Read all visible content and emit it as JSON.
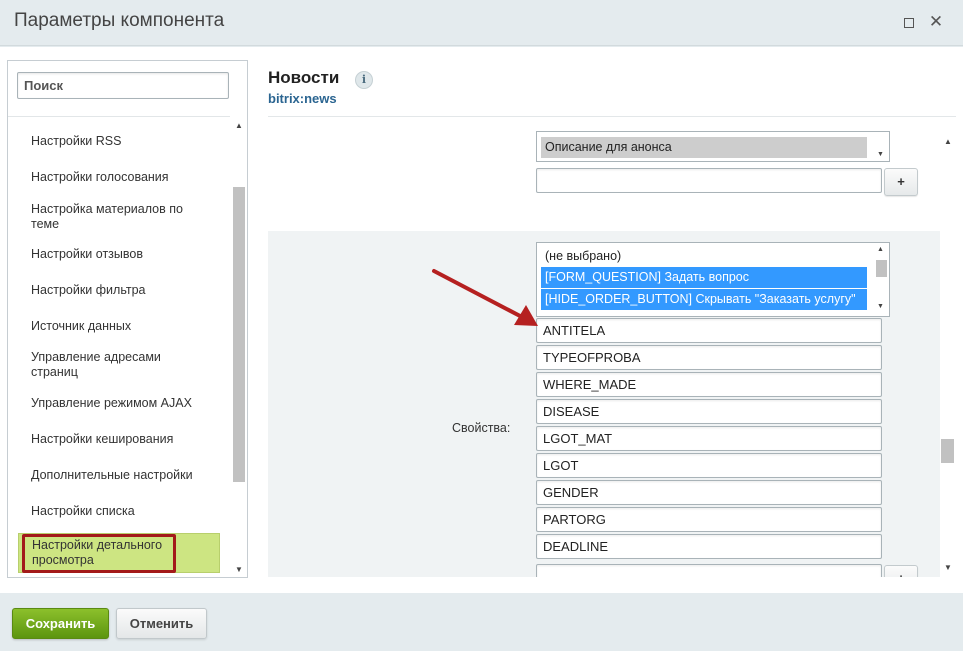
{
  "window": {
    "title": "Параметры компонента"
  },
  "sidebar": {
    "search_placeholder": "Поиск",
    "items": [
      {
        "label": "Настройки RSS"
      },
      {
        "label": "Настройки голосования"
      },
      {
        "label": "Настройка материалов по теме"
      },
      {
        "label": "Настройки отзывов"
      },
      {
        "label": "Настройки фильтра"
      },
      {
        "label": "Источник данных"
      },
      {
        "label": "Управление адресами страниц"
      },
      {
        "label": "Управление режимом AJAX"
      },
      {
        "label": "Настройки кеширования"
      },
      {
        "label": "Дополнительные настройки"
      },
      {
        "label": "Настройки списка"
      },
      {
        "label": "Настройки детального просмотра"
      }
    ]
  },
  "header": {
    "title": "Новости",
    "info_icon": "i",
    "component_code": "bitrix:news"
  },
  "top_field": {
    "selected_option": "Описание для анонса",
    "input_value": "",
    "add_label": "+"
  },
  "properties": {
    "label": "Свойства:",
    "options": [
      {
        "label": "(не выбрано)",
        "selected": false
      },
      {
        "label": "[FORM_QUESTION] Задать вопрос",
        "selected": true
      },
      {
        "label": "[HIDE_ORDER_BUTTON] Скрывать \"Заказать услугу\"",
        "selected": true
      }
    ],
    "inputs": [
      "ANTITELA",
      "TYPEOFPROBA",
      "WHERE_MADE",
      "DISEASE",
      "LGOT_MAT",
      "LGOT",
      "GENDER",
      "PARTORG",
      "DEADLINE",
      ""
    ],
    "add_label": "+"
  },
  "footer": {
    "save_label": "Сохранить",
    "cancel_label": "Отменить"
  },
  "colors": {
    "accent_green": "#6fa81b",
    "selection_blue": "#3399ff",
    "annotation_red": "#a31a1a",
    "link_blue": "#2b6591"
  },
  "icons": {
    "maximize": "maximize-icon",
    "close": "close-icon",
    "info": "info-icon",
    "annotation": "red-arrow-annotation"
  }
}
